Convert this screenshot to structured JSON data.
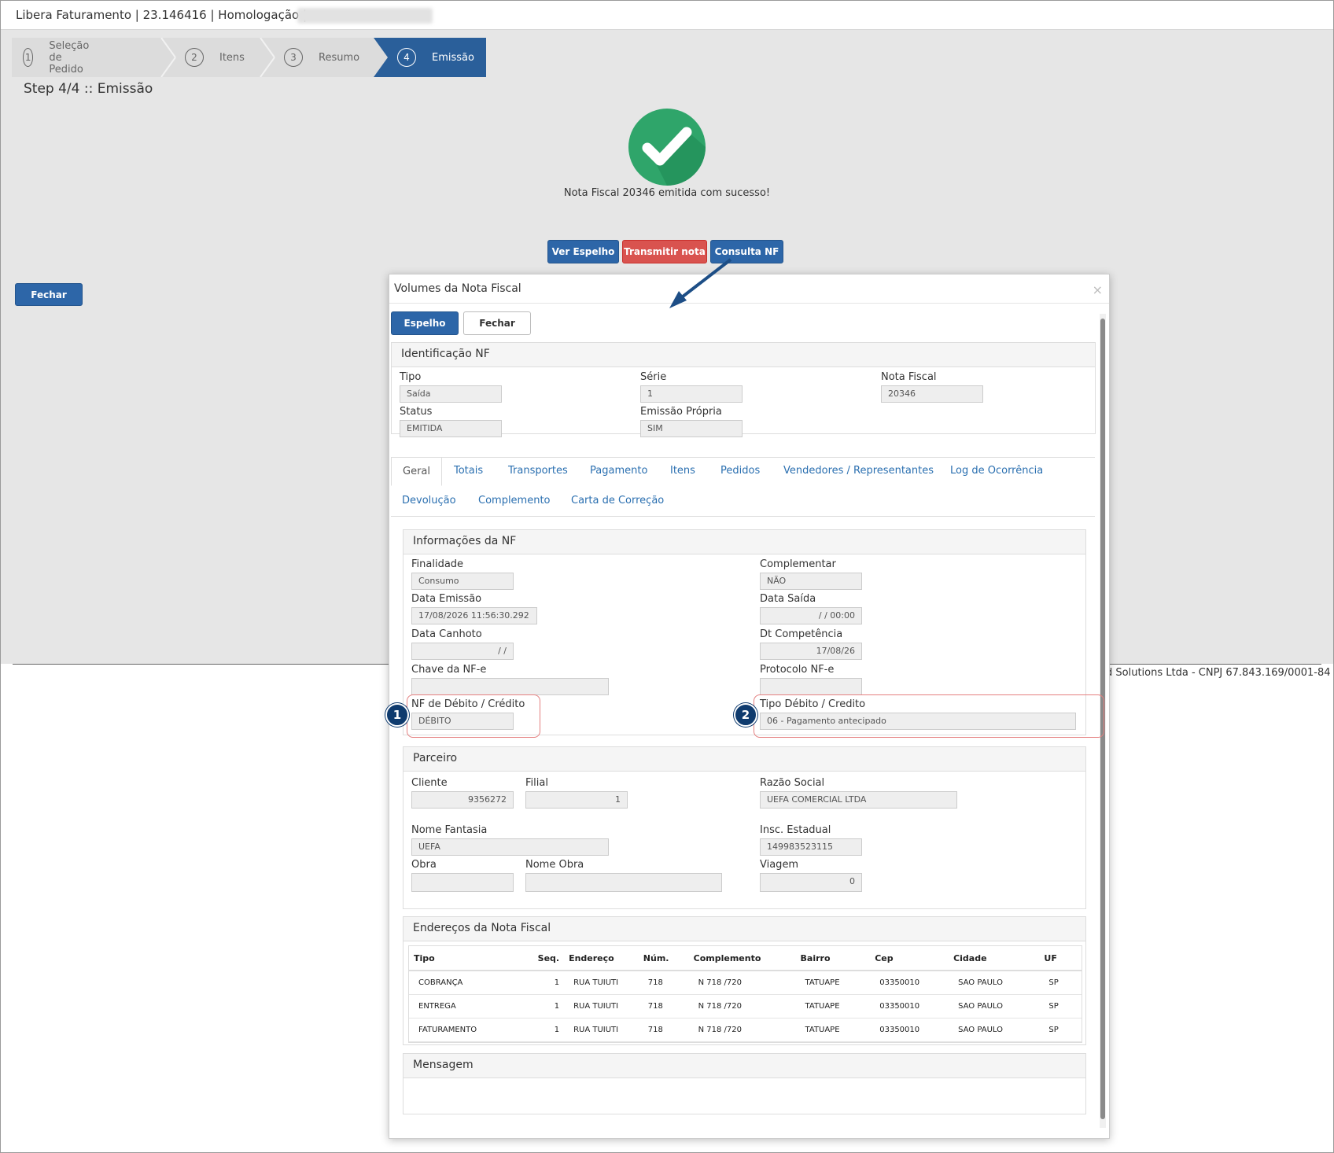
{
  "window": {
    "title": "Libera Faturamento | 23.146416 | Homologação |"
  },
  "wizard": {
    "steps": [
      {
        "num": "1",
        "label": "Seleção de Pedido"
      },
      {
        "num": "2",
        "label": "Itens"
      },
      {
        "num": "3",
        "label": "Resumo"
      },
      {
        "num": "4",
        "label": "Emissão"
      }
    ],
    "active_step": 4,
    "step_title": "Step 4/4 :: Emissão"
  },
  "success": {
    "icon": "check-circle-icon",
    "message": "Nota Fiscal 20346 emitida com sucesso!"
  },
  "actions": {
    "ver_espelho": "Ver Espelho",
    "transmitir": "Transmitir nota",
    "consulta": "Consulta NF",
    "fechar": "Fechar"
  },
  "footer": {
    "text": "d Solutions Ltda - CNPJ 67.843.169/0001-84"
  },
  "modal": {
    "title": "Volumes da Nota Fiscal",
    "close": "×",
    "buttons": {
      "espelho": "Espelho",
      "fechar": "Fechar"
    },
    "ident": {
      "title": "Identificação NF",
      "tipo_label": "Tipo",
      "tipo": "Saída",
      "serie_label": "Série",
      "serie": "1",
      "nf_label": "Nota Fiscal",
      "nf": "20346",
      "status_label": "Status",
      "status": "EMITIDA",
      "emissao_label": "Emissão Própria",
      "emissao": "SIM"
    },
    "tabs": [
      "Geral",
      "Totais",
      "Transportes",
      "Pagamento",
      "Itens",
      "Pedidos",
      "Vendedores / Representantes",
      "Log de Ocorrência",
      "Devolução",
      "Complemento",
      "Carta de Correção"
    ],
    "info": {
      "title": "Informações da NF",
      "finalidade_label": "Finalidade",
      "finalidade": "Consumo",
      "complementar_label": "Complementar",
      "complementar": "NÃO",
      "data_emissao_label": "Data Emissão",
      "data_emissao": "17/08/2026 11:56:30.292",
      "data_saida_label": "Data Saída",
      "data_saida": "/ / 00:00",
      "data_canhoto_label": "Data Canhoto",
      "data_canhoto": "/ /",
      "dt_competencia_label": "Dt Competência",
      "dt_competencia": "17/08/26",
      "chave_label": "Chave da NF-e",
      "chave": "",
      "protocolo_label": "Protocolo NF-e",
      "protocolo": "",
      "debcred_label": "NF de Débito / Crédito",
      "debcred": "DÉBITO",
      "tipo_debcred_label": "Tipo Débito / Credito",
      "tipo_debcred": "06 - Pagamento antecipado",
      "badge1": "1",
      "badge2": "2"
    },
    "parceiro": {
      "title": "Parceiro",
      "cliente_label": "Cliente",
      "cliente": "9356272",
      "filial_label": "Filial",
      "filial": "1",
      "razao_label": "Razão Social",
      "razao": "UEFA COMERCIAL LTDA",
      "fantasia_label": "Nome Fantasia",
      "fantasia": "UEFA",
      "insc_label": "Insc. Estadual",
      "insc": "149983523115",
      "obra_label": "Obra",
      "obra": "",
      "nome_obra_label": "Nome Obra",
      "nome_obra": "",
      "viagem_label": "Viagem",
      "viagem": "0"
    },
    "enderecos": {
      "title": "Endereços da Nota Fiscal",
      "headers": [
        "Tipo",
        "Seq.",
        "Endereço",
        "Núm.",
        "Complemento",
        "Bairro",
        "Cep",
        "Cidade",
        "UF"
      ],
      "rows": [
        [
          "COBRANÇA",
          "1",
          "RUA TUIUTI",
          "718",
          "N 718 /720",
          "TATUAPE",
          "03350010",
          "SAO PAULO",
          "SP"
        ],
        [
          "ENTREGA",
          "1",
          "RUA TUIUTI",
          "718",
          "N 718 /720",
          "TATUAPE",
          "03350010",
          "SAO PAULO",
          "SP"
        ],
        [
          "FATURAMENTO",
          "1",
          "RUA TUIUTI",
          "718",
          "N 718 /720",
          "TATUAPE",
          "03350010",
          "SAO PAULO",
          "SP"
        ]
      ]
    },
    "mensagem": {
      "title": "Mensagem"
    }
  }
}
